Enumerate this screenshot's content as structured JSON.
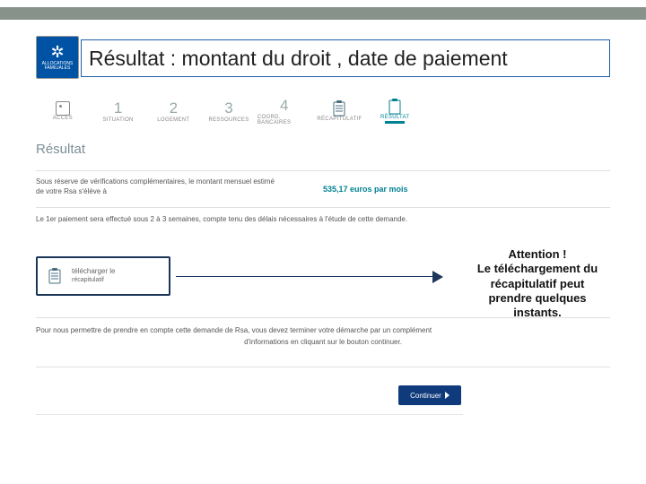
{
  "topbar_color": "#87928b",
  "logo": {
    "label": "ALLOCATIONS FAMILIALES"
  },
  "title": "Résultat : montant du droit , date de paiement",
  "steps": [
    {
      "key": "acces",
      "label": "ACCÈS"
    },
    {
      "key": "1",
      "num": "1",
      "label": "SITUATION"
    },
    {
      "key": "2",
      "num": "2",
      "label": "LOGEMENT"
    },
    {
      "key": "3",
      "num": "3",
      "label": "RESSOURCES"
    },
    {
      "key": "4",
      "num": "4",
      "label": "COORD. BANCAIRES"
    },
    {
      "key": "recap",
      "label": "RÉCAPITULATIF"
    },
    {
      "key": "result",
      "label": "RÉSULTAT",
      "active": true
    }
  ],
  "section_heading": "Résultat",
  "result_line1a": "Sous réserve de vérifications complémentaires, le montant mensuel estimé",
  "result_line1b": "de votre Rsa s'élève à",
  "amount": "535,17 euros par mois",
  "result_line2": "Le 1er paiement sera effectué sous 2 à 3 semaines, compte tenu des délais nécessaires à l'étude de cette demande.",
  "download": {
    "line1": "télécharger le",
    "line2": "récapitulatif"
  },
  "attention": {
    "l1": "Attention !",
    "l2": "Le téléchargement du",
    "l3": "récapitulatif peut",
    "l4": "prendre quelques",
    "l5": "instants."
  },
  "continue_text1": "Pour nous permettre de prendre en compte cette demande de Rsa, vous devez terminer votre démarche par un complément",
  "continue_text2": "d'informations en cliquant sur le bouton continuer.",
  "continue_label": "Continuer"
}
